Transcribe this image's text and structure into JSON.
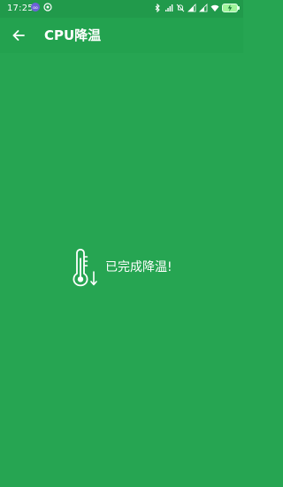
{
  "status_bar": {
    "time": "17:25",
    "battery_charging": true
  },
  "app_bar": {
    "title": "CPU降温",
    "back_icon": "arrow-left-icon"
  },
  "content": {
    "icon": "thermometer-down-icon",
    "message": "已完成降温!"
  },
  "colors": {
    "background": "#26a552",
    "app_bar": "#23a24f",
    "text": "#ffffff"
  }
}
